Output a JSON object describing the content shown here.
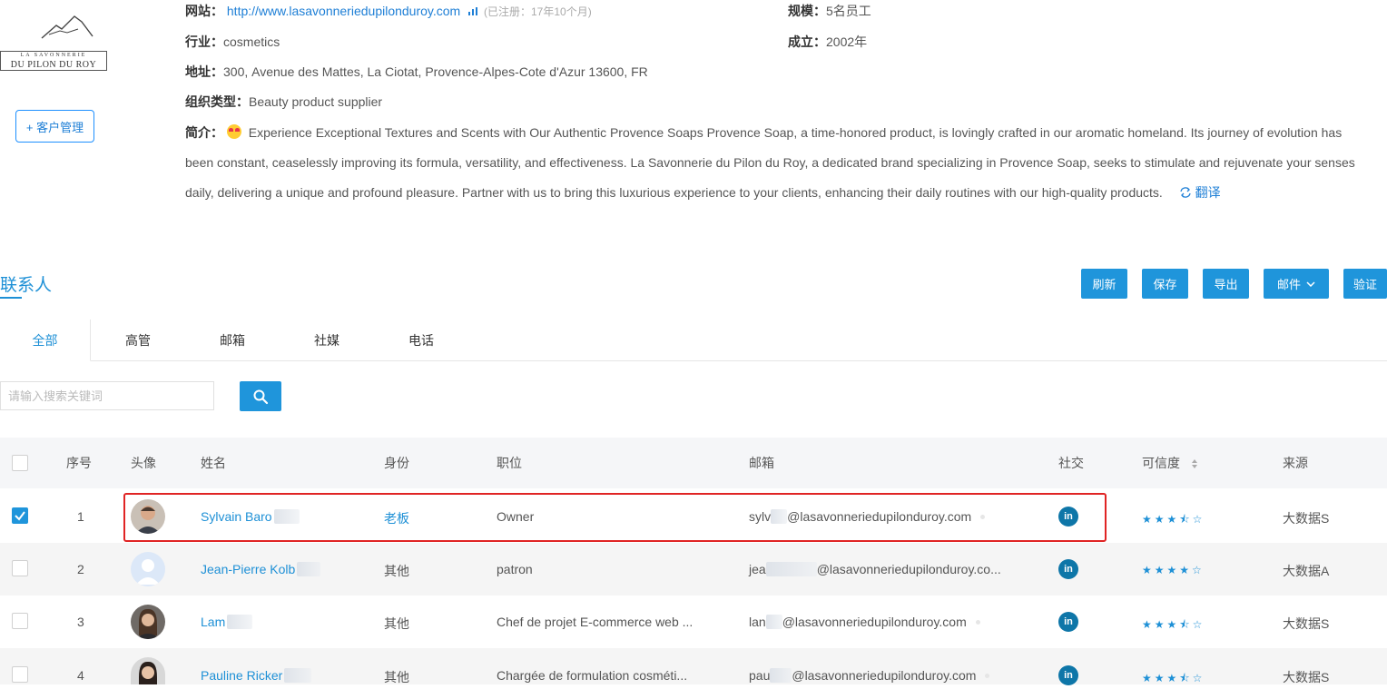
{
  "company": {
    "website_label": "网站：",
    "website": "http://www.lasavonneriedupilonduroy.com",
    "registered": "(已注册：17年10个月)",
    "industry_label": "行业：",
    "industry": "cosmetics",
    "address_label": "地址：",
    "address": "300, Avenue des Mattes, La Ciotat, Provence-Alpes-Cote d'Azur 13600, FR",
    "org_type_label": "组织类型：",
    "org_type": "Beauty product supplier",
    "scale_label": "规模：",
    "scale": "5名员工",
    "founded_label": "成立：",
    "founded": "2002年",
    "intro_label": "简介：",
    "intro": "Experience Exceptional Textures and Scents with Our Authentic Provence Soaps Provence Soap, a time-honored product, is lovingly crafted in our aromatic homeland. Its journey of evolution has been constant, ceaselessly improving its formula, versatility, and effectiveness. La Savonnerie du Pilon du Roy, a dedicated brand specializing in Provence Soap, seeks to stimulate and rejuvenate your senses daily, delivering a unique and profound pleasure. Partner with us to bring this luxurious experience to your clients, enhancing their daily routines with our high-quality products.",
    "translate": "翻译",
    "logo_line1": "LA SAVONNERIE",
    "logo_line2": "DU PILON DU ROY",
    "crm_button": "+ 客户管理"
  },
  "contacts": {
    "title": "联系人",
    "buttons": [
      "刷新",
      "保存",
      "导出",
      "邮件",
      "验证"
    ],
    "tabs": [
      "全部",
      "高管",
      "邮箱",
      "社媒",
      "电话"
    ],
    "search_placeholder": "请输入搜索关键词",
    "headers": [
      "序号",
      "头像",
      "姓名",
      "身份",
      "职位",
      "邮箱",
      "社交",
      "可信度",
      "来源"
    ],
    "rows": [
      {
        "index": "1",
        "name": "Sylvain Baro",
        "identity": "老板",
        "position": "Owner",
        "email_prefix": "sylv",
        "email_domain": "@lasavonneriedupilonduroy.com",
        "social": "in",
        "rating": 3.5,
        "stars": "★★★⯪☆",
        "source": "大数据S",
        "checked": true
      },
      {
        "index": "2",
        "name": "Jean-Pierre Kolb",
        "identity": "其他",
        "position": "patron",
        "email_prefix": "jea",
        "email_domain": "@lasavonneriedupilonduroy.co...",
        "social": "in",
        "rating": 4,
        "stars": "★★★★☆",
        "source": "大数据A",
        "checked": false
      },
      {
        "index": "3",
        "name": "Lam",
        "identity": "其他",
        "position": "Chef de projet E-commerce web ...",
        "email_prefix": "lan",
        "email_domain": "@lasavonneriedupilonduroy.com",
        "social": "in",
        "rating": 3.5,
        "stars": "★★★⯪☆",
        "source": "大数据S",
        "checked": false
      },
      {
        "index": "4",
        "name": "Pauline Ricker",
        "identity": "其他",
        "position": "Chargée de formulation cosméti...",
        "email_prefix": "pau",
        "email_domain": "@lasavonneriedupilonduroy.com",
        "social": "in",
        "rating": 3.5,
        "stars": "★★★⯪☆",
        "source": "大数据S",
        "checked": false
      }
    ]
  },
  "colors": {
    "accent": "#1f95db",
    "highlight": "#e02424",
    "linkedin": "#0e76a8"
  }
}
